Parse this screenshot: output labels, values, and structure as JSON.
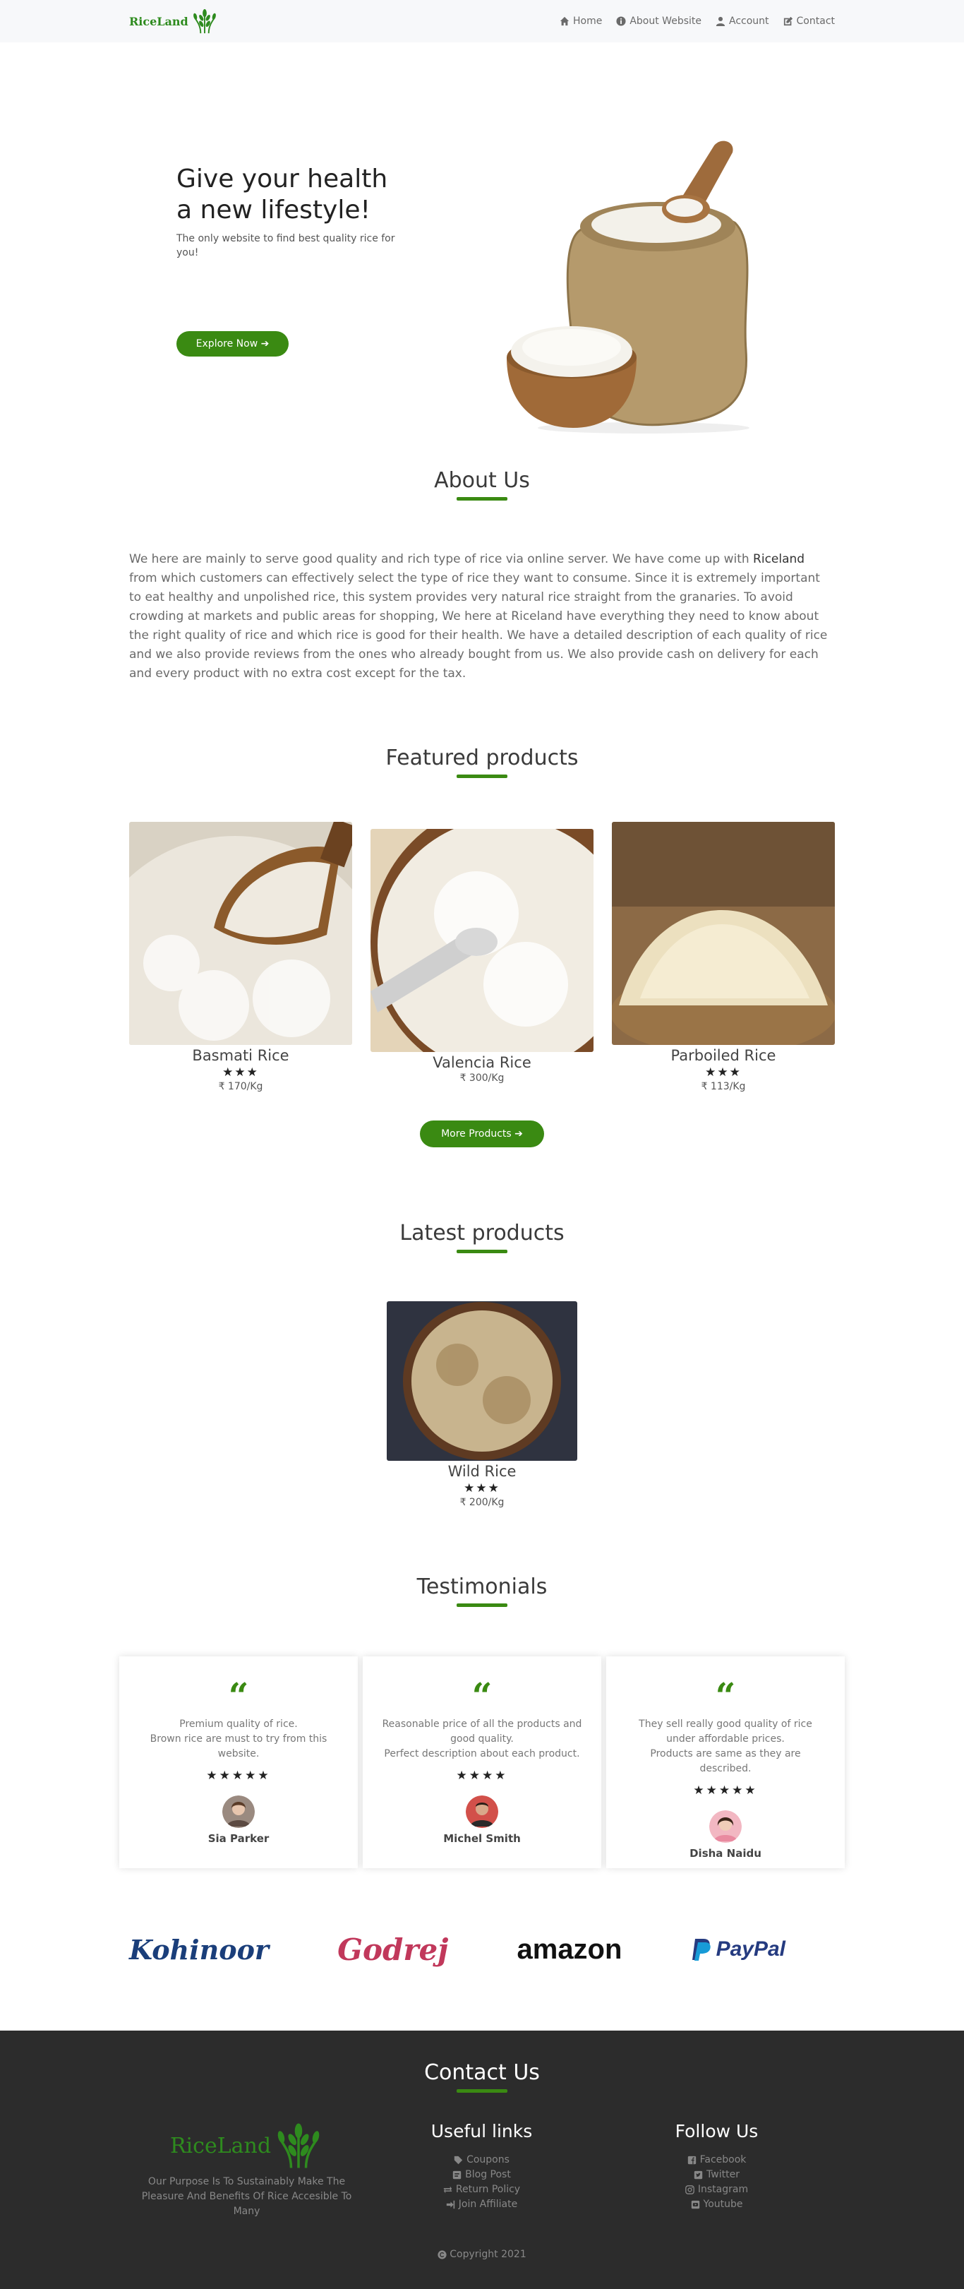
{
  "nav": {
    "brand": "RiceLand",
    "links": [
      {
        "label": "Home",
        "icon": "home-icon"
      },
      {
        "label": "About Website",
        "icon": "info-icon"
      },
      {
        "label": "Account",
        "icon": "user-icon"
      },
      {
        "label": "Contact",
        "icon": "edit-icon"
      }
    ]
  },
  "hero": {
    "title_line1": "Give your health",
    "title_line2": "a new lifestyle!",
    "subtitle": "The only website to find best quality rice for you!",
    "button": "Explore Now ➔"
  },
  "about": {
    "title": "About Us",
    "text_before": "We here are mainly to serve good quality and rich type of rice via online server. We have come up with ",
    "brand": "Riceland",
    "text_after": " from which customers can effectively select the type of rice they want to consume. Since it is extremely important to eat healthy and unpolished rice, this system provides very natural rice straight from the granaries. To avoid crowding at markets and public areas for shopping, We here at Riceland have everything they need to know about the right quality of rice and which rice is good for their health. We have a detailed description of each quality of rice and we also provide reviews from the ones who already bought from us. We also provide cash on delivery for each and every product with no extra cost except for the tax."
  },
  "featured": {
    "title": "Featured products",
    "products": [
      {
        "name": "Basmati Rice",
        "stars": "★★★",
        "price": "₹ 170/Kg"
      },
      {
        "name": "Valencia Rice",
        "stars": "",
        "price": "₹ 300/Kg"
      },
      {
        "name": "Parboiled Rice",
        "stars": "★★★",
        "price": "₹ 113/Kg"
      }
    ],
    "more_button": "More Products ➔"
  },
  "latest": {
    "title": "Latest products",
    "product": {
      "name": "Wild Rice",
      "stars": "★★★",
      "price": "₹ 200/Kg"
    }
  },
  "testimonials": {
    "title": "Testimonials",
    "quote_glyph": "“",
    "items": [
      {
        "text": "Premium quality of rice.\nBrown rice are must to try from this website.",
        "stars": "★★★★★",
        "name": "Sia Parker"
      },
      {
        "text": "Reasonable price of all the products and good quality.\nPerfect description about each product.",
        "stars": "★★★★",
        "name": "Michel Smith"
      },
      {
        "text": "They sell really good quality of rice under affordable prices.\nProducts are same as they are described.",
        "stars": "★★★★★",
        "name": "Disha Naidu"
      }
    ]
  },
  "brands": [
    "Kohinoor",
    "Godrej",
    "amazon",
    "PayPal"
  ],
  "footer": {
    "contact_title": "Contact Us",
    "brand": "RiceLand",
    "tagline": "Our Purpose Is To Sustainably Make The Pleasure And Benefits Of Rice Accesible To Many",
    "useful_title": "Useful links",
    "useful_links": [
      "Coupons",
      "Blog Post",
      "Return Policy",
      "Join Affiliate"
    ],
    "follow_title": "Follow Us",
    "follow_links": [
      "Facebook",
      "Twitter",
      "Instagram",
      "Youtube"
    ],
    "copyright": "Copyright 2021"
  },
  "colors": {
    "accent": "#3a8a12",
    "brand": "#2e8b1e",
    "footer_bg": "#2c2c2c"
  }
}
